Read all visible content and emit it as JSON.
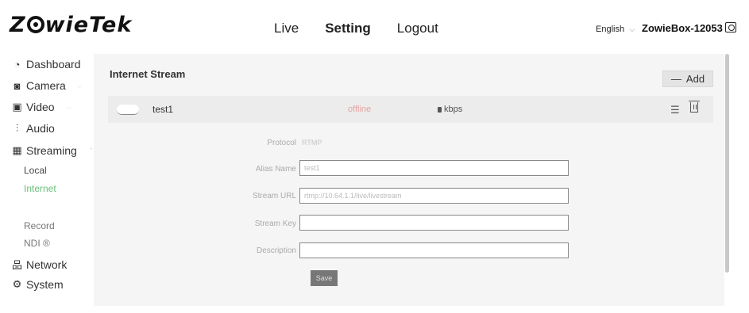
{
  "header": {
    "logo_text": "ZowieTek",
    "nav": [
      "Live",
      "Setting",
      "Logout"
    ],
    "language": "English",
    "device_name": "ZowieBox-12053"
  },
  "sidebar": {
    "items": [
      {
        "label": "Dashboard",
        "icon": "dashboard-icon"
      },
      {
        "label": "Camera",
        "icon": "camera-icon"
      },
      {
        "label": "Video",
        "icon": "video-icon"
      },
      {
        "label": "Audio",
        "icon": "audio-icon"
      },
      {
        "label": "Streaming",
        "icon": "streaming-icon"
      },
      {
        "label": "Network",
        "icon": "network-icon"
      },
      {
        "label": "System",
        "icon": "system-icon"
      }
    ],
    "sub_items": [
      "Local",
      "Internet",
      "Record",
      "NDI ®"
    ]
  },
  "main": {
    "title": "Internet Stream",
    "add_label": "Add",
    "stream": {
      "name": "test1",
      "status": "offline",
      "bitrate_unit": "kbps",
      "enabled": false
    },
    "form": {
      "protocol_label": "Protocol",
      "protocol_value": "RTMP",
      "alias_label": "Alias Name",
      "alias_value": "test1",
      "url_label": "Stream URL",
      "url_value": "rtmp://10.64.1.1/live/livestream",
      "key_label": "Stream Key",
      "key_value": "",
      "description_label": "Description",
      "description_value": "",
      "save_label": "Save"
    }
  },
  "colors": {
    "active_menu": "#6abf7b",
    "offline": "#e7a4a4",
    "panel_bg": "#f5f5f5"
  }
}
